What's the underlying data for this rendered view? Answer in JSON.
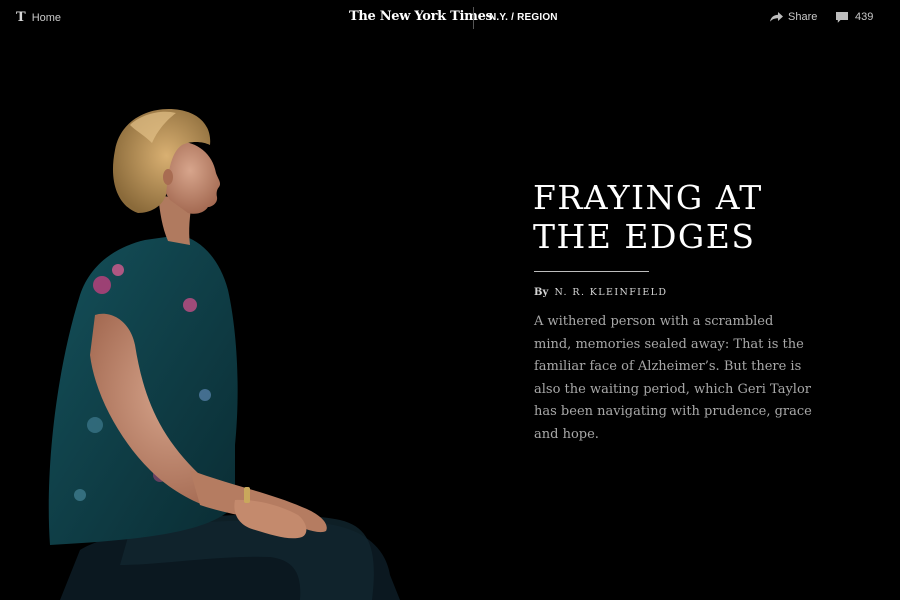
{
  "header": {
    "logo_glyph": "T",
    "home_label": "Home",
    "masthead": "The New York Times",
    "section": "N.Y. / REGION",
    "share_label": "Share",
    "comment_count": "439"
  },
  "article": {
    "headline_line1": "FRAYING AT",
    "headline_line2": "THE EDGES",
    "byline_prefix": "By",
    "author": "N. R. KLEINFIELD",
    "summary": "A withered person with a scrambled mind, memories sealed away: That is the familiar face of Alzheimer’s. But there is also the waiting period, which Geri Taylor has been navigating with prudence, grace and hope."
  },
  "colors": {
    "background": "#000000",
    "headline": "#ffffff",
    "summary_text": "#a8a8a8",
    "topbar_text": "#c9c9c9"
  },
  "icons": {
    "home": "t-logo-icon",
    "share": "share-arrow-icon",
    "comments": "comment-bubble-icon"
  }
}
